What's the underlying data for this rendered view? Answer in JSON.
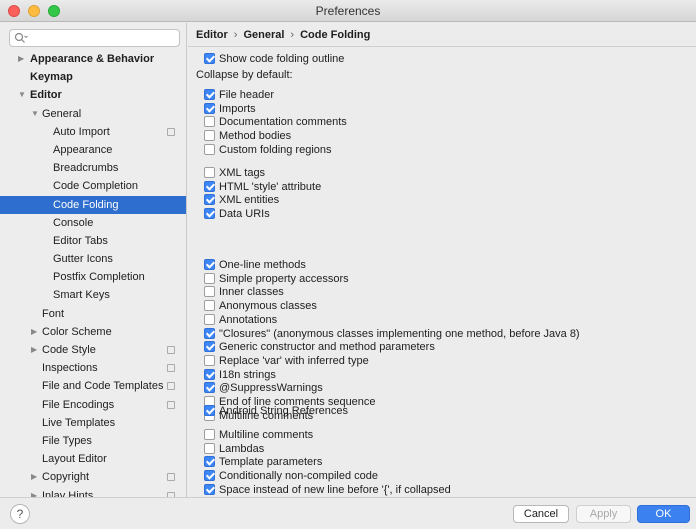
{
  "window": {
    "title": "Preferences"
  },
  "search": {
    "placeholder": "Q-"
  },
  "sidebar": {
    "items": [
      {
        "label": "Appearance & Behavior",
        "arrow": "▶",
        "indent": 0,
        "bold": true,
        "proj": false,
        "selected": false
      },
      {
        "label": "Keymap",
        "arrow": "",
        "indent": 0,
        "bold": true,
        "proj": false,
        "selected": false
      },
      {
        "label": "Editor",
        "arrow": "▼",
        "indent": 0,
        "bold": true,
        "proj": false,
        "selected": false
      },
      {
        "label": "General",
        "arrow": "▼",
        "indent": 1,
        "bold": false,
        "proj": false,
        "selected": false
      },
      {
        "label": "Auto Import",
        "arrow": "",
        "indent": 2,
        "bold": false,
        "proj": true,
        "selected": false
      },
      {
        "label": "Appearance",
        "arrow": "",
        "indent": 2,
        "bold": false,
        "proj": false,
        "selected": false
      },
      {
        "label": "Breadcrumbs",
        "arrow": "",
        "indent": 2,
        "bold": false,
        "proj": false,
        "selected": false
      },
      {
        "label": "Code Completion",
        "arrow": "",
        "indent": 2,
        "bold": false,
        "proj": false,
        "selected": false
      },
      {
        "label": "Code Folding",
        "arrow": "",
        "indent": 2,
        "bold": false,
        "proj": false,
        "selected": true
      },
      {
        "label": "Console",
        "arrow": "",
        "indent": 2,
        "bold": false,
        "proj": false,
        "selected": false
      },
      {
        "label": "Editor Tabs",
        "arrow": "",
        "indent": 2,
        "bold": false,
        "proj": false,
        "selected": false
      },
      {
        "label": "Gutter Icons",
        "arrow": "",
        "indent": 2,
        "bold": false,
        "proj": false,
        "selected": false
      },
      {
        "label": "Postfix Completion",
        "arrow": "",
        "indent": 2,
        "bold": false,
        "proj": false,
        "selected": false
      },
      {
        "label": "Smart Keys",
        "arrow": "",
        "indent": 2,
        "bold": false,
        "proj": false,
        "selected": false
      },
      {
        "label": "Font",
        "arrow": "",
        "indent": 1,
        "bold": false,
        "proj": false,
        "selected": false
      },
      {
        "label": "Color Scheme",
        "arrow": "▶",
        "indent": 1,
        "bold": false,
        "proj": false,
        "selected": false
      },
      {
        "label": "Code Style",
        "arrow": "▶",
        "indent": 1,
        "bold": false,
        "proj": true,
        "selected": false
      },
      {
        "label": "Inspections",
        "arrow": "",
        "indent": 1,
        "bold": false,
        "proj": true,
        "selected": false
      },
      {
        "label": "File and Code Templates",
        "arrow": "",
        "indent": 1,
        "bold": false,
        "proj": true,
        "selected": false
      },
      {
        "label": "File Encodings",
        "arrow": "",
        "indent": 1,
        "bold": false,
        "proj": true,
        "selected": false
      },
      {
        "label": "Live Templates",
        "arrow": "",
        "indent": 1,
        "bold": false,
        "proj": false,
        "selected": false
      },
      {
        "label": "File Types",
        "arrow": "",
        "indent": 1,
        "bold": false,
        "proj": false,
        "selected": false
      },
      {
        "label": "Layout Editor",
        "arrow": "",
        "indent": 1,
        "bold": false,
        "proj": false,
        "selected": false
      },
      {
        "label": "Copyright",
        "arrow": "▶",
        "indent": 1,
        "bold": false,
        "proj": true,
        "selected": false
      },
      {
        "label": "Inlay Hints",
        "arrow": "▶",
        "indent": 1,
        "bold": false,
        "proj": true,
        "selected": false
      }
    ]
  },
  "breadcrumb": [
    "Editor",
    "General",
    "Code Folding"
  ],
  "breadcrumb_sep": "›",
  "main": {
    "show_outline": {
      "label": "Show code folding outline",
      "checked": true
    },
    "collapse_label": "Collapse by default:",
    "groups": [
      [
        {
          "label": "File header",
          "checked": true
        },
        {
          "label": "Imports",
          "checked": true
        },
        {
          "label": "Documentation comments",
          "checked": false
        },
        {
          "label": "Method bodies",
          "checked": false
        },
        {
          "label": "Custom folding regions",
          "checked": false
        }
      ],
      [
        {
          "label": "XML tags",
          "checked": false
        },
        {
          "label": "HTML 'style' attribute",
          "checked": true
        },
        {
          "label": "XML entities",
          "checked": true
        },
        {
          "label": "Data URIs",
          "checked": true
        }
      ],
      [
        {
          "label": "One-line methods",
          "checked": true
        },
        {
          "label": "Simple property accessors",
          "checked": false
        },
        {
          "label": "Inner classes",
          "checked": false
        },
        {
          "label": "Anonymous classes",
          "checked": false
        },
        {
          "label": "Annotations",
          "checked": false
        },
        {
          "label": "\"Closures\" (anonymous classes implementing one method, before Java 8)",
          "checked": true
        },
        {
          "label": "Generic constructor and method parameters",
          "checked": true
        },
        {
          "label": "Replace 'var' with inferred type",
          "checked": false
        },
        {
          "label": "I18n strings",
          "checked": true
        },
        {
          "label": "@SuppressWarnings",
          "checked": true
        },
        {
          "label": "End of line comments sequence",
          "checked": false
        },
        {
          "label": "Multiline comments",
          "checked": false
        }
      ],
      [
        {
          "label": "Android String References",
          "checked": true
        }
      ],
      [
        {
          "label": "Multiline comments",
          "checked": false
        },
        {
          "label": "Lambdas",
          "checked": false
        },
        {
          "label": "Template parameters",
          "checked": true
        },
        {
          "label": "Conditionally non-compiled code",
          "checked": true
        },
        {
          "label": "Space instead of new line before '{', if collapsed",
          "checked": true
        }
      ]
    ]
  },
  "footer": {
    "help": "?",
    "cancel": "Cancel",
    "apply": "Apply",
    "ok": "OK"
  }
}
